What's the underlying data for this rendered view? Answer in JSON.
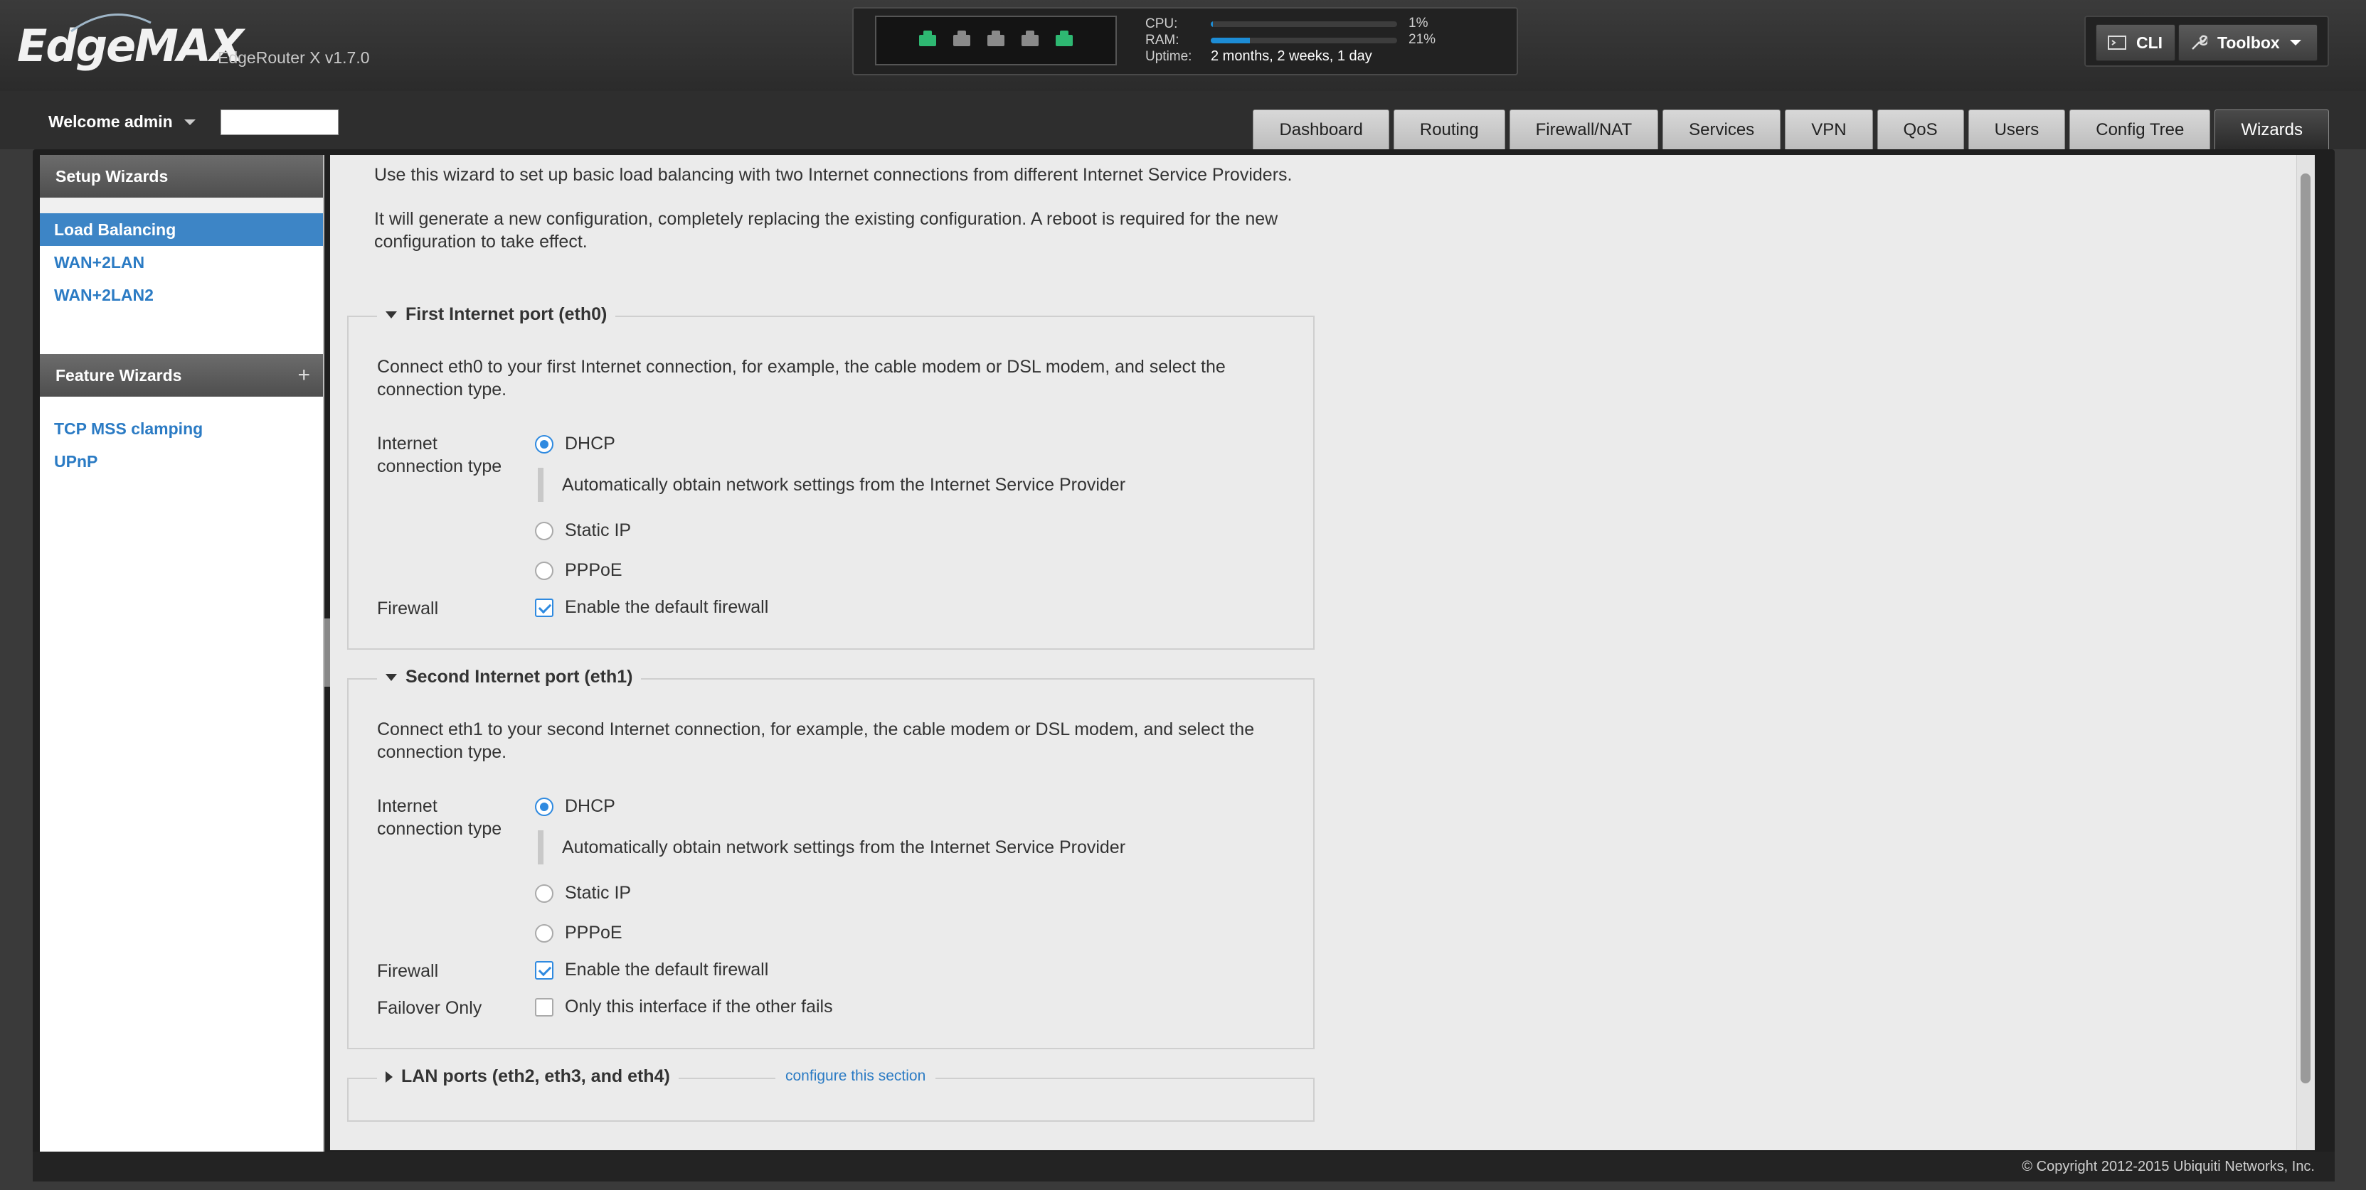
{
  "header": {
    "logo": "EdgeMAX",
    "device_version": "EdgeRouter X v1.7.0",
    "ports": [
      {
        "name": "eth0",
        "status": "up"
      },
      {
        "name": "eth1",
        "status": "down"
      },
      {
        "name": "eth2",
        "status": "down"
      },
      {
        "name": "eth3",
        "status": "down"
      },
      {
        "name": "eth4",
        "status": "up"
      }
    ],
    "stats": {
      "cpu_label": "CPU:",
      "cpu_value": "1%",
      "cpu_fraction": 0.01,
      "ram_label": "RAM:",
      "ram_value": "21%",
      "ram_fraction": 0.21,
      "uptime_label": "Uptime:",
      "uptime_value": "2 months, 2 weeks, 1 day"
    },
    "cli_label": "CLI",
    "toolbox_label": "Toolbox"
  },
  "subheader": {
    "welcome": "Welcome admin",
    "tabs": [
      "Dashboard",
      "Routing",
      "Firewall/NAT",
      "Services",
      "VPN",
      "QoS",
      "Users",
      "Config Tree",
      "Wizards"
    ],
    "active_tab": "Wizards"
  },
  "sidebar": {
    "setup_title": "Setup Wizards",
    "setup_items": [
      "Load Balancing",
      "WAN+2LAN",
      "WAN+2LAN2"
    ],
    "active_item": "Load Balancing",
    "feature_title": "Feature Wizards",
    "feature_add": "+",
    "feature_items": [
      "TCP MSS clamping",
      "UPnP"
    ]
  },
  "main": {
    "intro1": "Use this wizard to set up basic load balancing with two Internet connections from different Internet Service Providers.",
    "intro2": "It will generate a new configuration, completely replacing the existing configuration. A reboot is required for the new configuration to take effect.",
    "first": {
      "legend": "First Internet port (eth0)",
      "desc": "Connect eth0 to your first Internet connection, for example, the cable modem or DSL modem, and select the connection type.",
      "conn_label": "Internet connection type",
      "dhcp": "DHCP",
      "dhcp_hint": "Automatically obtain network settings from the Internet Service Provider",
      "static": "Static IP",
      "pppoe": "PPPoE",
      "firewall_label": "Firewall",
      "firewall_option": "Enable the default firewall"
    },
    "second": {
      "legend": "Second Internet port (eth1)",
      "desc": "Connect eth1 to your second Internet connection, for example, the cable modem or DSL modem, and select the connection type.",
      "conn_label": "Internet connection type",
      "dhcp": "DHCP",
      "dhcp_hint": "Automatically obtain network settings from the Internet Service Provider",
      "static": "Static IP",
      "pppoe": "PPPoE",
      "firewall_label": "Firewall",
      "firewall_option": "Enable the default firewall",
      "failover_label": "Failover Only",
      "failover_option": "Only this interface if the other fails"
    },
    "lan": {
      "legend": "LAN ports (eth2, eth3, and eth4)",
      "configure_link": "configure this section"
    }
  },
  "footer": {
    "copyright": "© Copyright 2012-2015 Ubiquiti Networks, Inc."
  },
  "colors": {
    "accent": "#2f8ae0",
    "link": "#2b7bc4",
    "sidebar_active": "#3d85c6",
    "port_up": "#2eb872",
    "port_down": "#8a8a8a",
    "bar_fill": "#1d8dd6"
  }
}
